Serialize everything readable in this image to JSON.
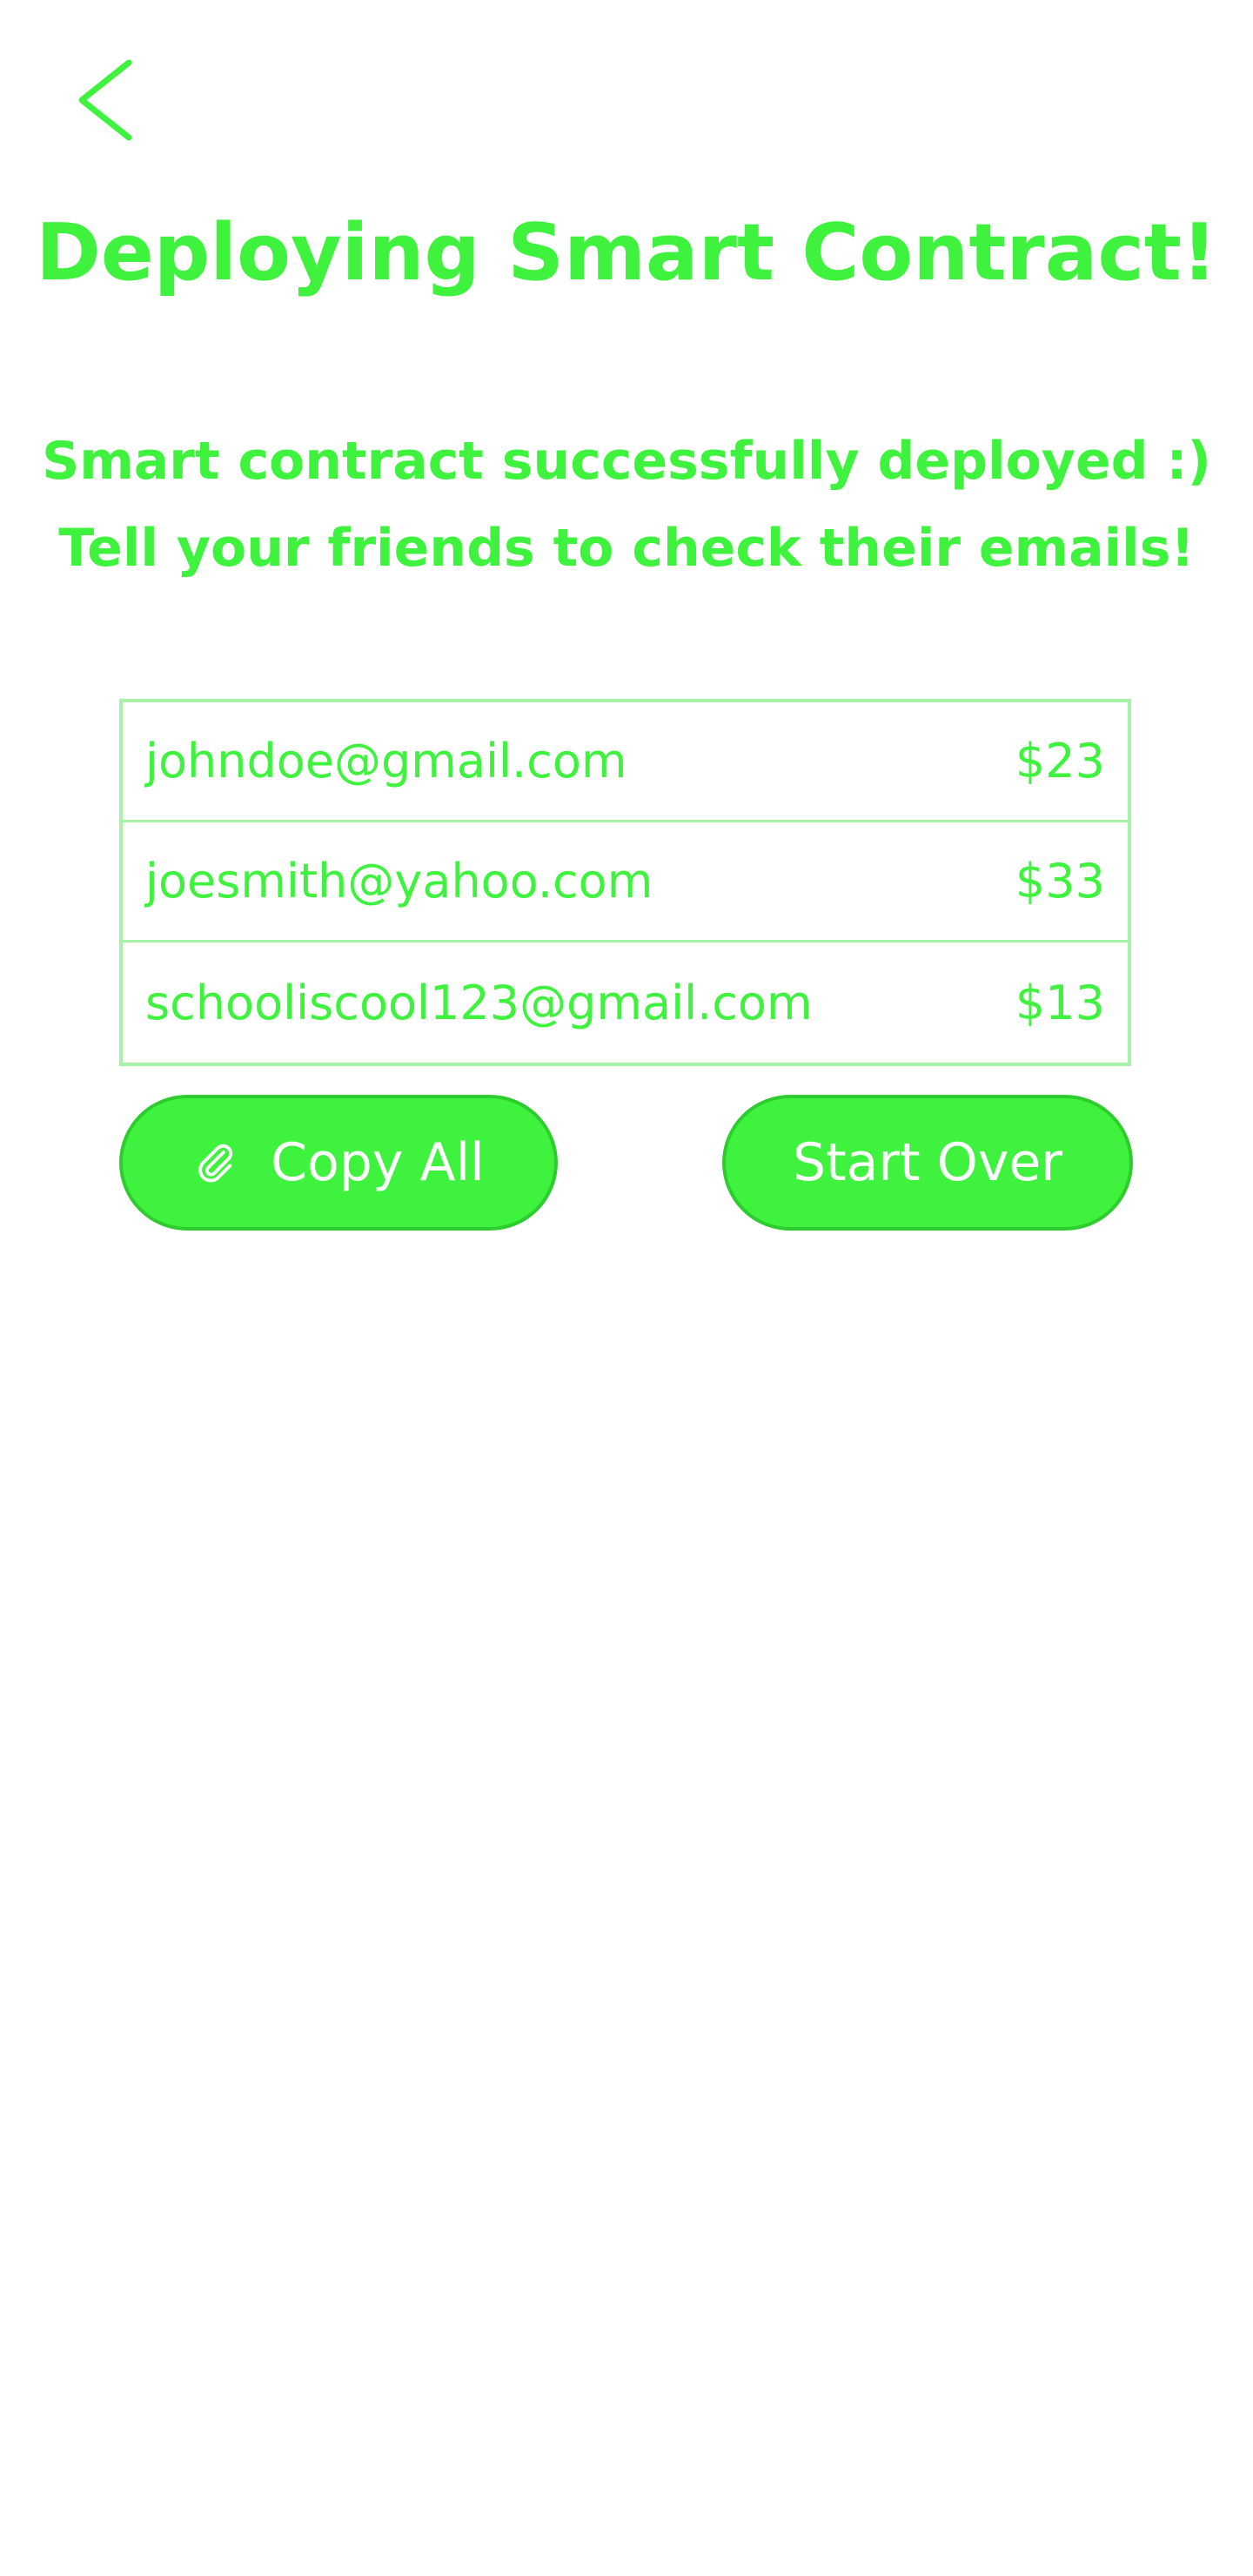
{
  "header": {
    "back_icon": "chevron-left-icon",
    "title": "Deploying Smart Contract!"
  },
  "message": {
    "line1": "Smart contract successfully deployed :)",
    "line2": "Tell your friends to check their emails!"
  },
  "recipients": [
    {
      "email": "johndoe@gmail.com",
      "amount": "$23"
    },
    {
      "email": "joesmith@yahoo.com",
      "amount": "$33"
    },
    {
      "email": "schooliscool123@gmail.com",
      "amount": "$13"
    }
  ],
  "actions": {
    "copy_all_label": "Copy All",
    "copy_icon": "paperclip-icon",
    "start_over_label": "Start Over"
  },
  "colors": {
    "accent": "#3ef23e",
    "border": "#a8f2a8",
    "button_border": "#2ecc2e",
    "background": "#ffffff"
  }
}
